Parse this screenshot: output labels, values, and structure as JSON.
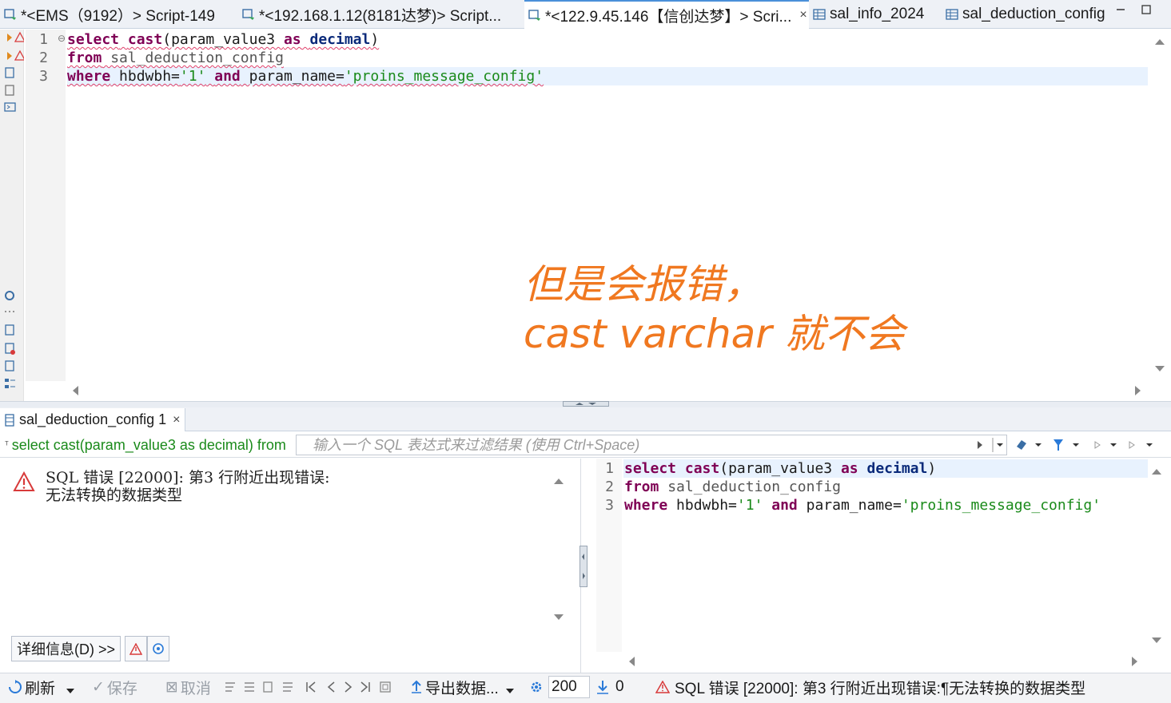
{
  "tabs": [
    {
      "label": "*<EMS（9192）> Script-149",
      "icon": "sql-script-icon",
      "active": false
    },
    {
      "label": "*<192.168.1.12(8181达梦)> Script...",
      "icon": "sql-script-icon",
      "active": false
    },
    {
      "label": "*<122.9.45.146【信创达梦】> Scri...",
      "icon": "sql-script-icon",
      "active": true,
      "close": "×"
    },
    {
      "label": "sal_info_2024",
      "icon": "table-icon",
      "active": false
    },
    {
      "label": "sal_deduction_config",
      "icon": "table-icon",
      "active": false
    }
  ],
  "editor": {
    "line_numbers": [
      "1",
      "2",
      "3"
    ],
    "lines": [
      [
        {
          "t": "select",
          "c": "kw"
        },
        {
          "t": " ",
          "c": "id"
        },
        {
          "t": "cast",
          "c": "kw"
        },
        {
          "t": "(param_value3 ",
          "c": "id"
        },
        {
          "t": "as",
          "c": "kw"
        },
        {
          "t": " ",
          "c": "id"
        },
        {
          "t": "decimal",
          "c": "kw2"
        },
        {
          "t": ")",
          "c": "id"
        }
      ],
      [
        {
          "t": "from",
          "c": "kw"
        },
        {
          "t": " sal_deduction_config",
          "c": "tbl"
        }
      ],
      [
        {
          "t": "where",
          "c": "kw"
        },
        {
          "t": " hbdwbh=",
          "c": "id"
        },
        {
          "t": "'1'",
          "c": "str"
        },
        {
          "t": " ",
          "c": "id"
        },
        {
          "t": "and",
          "c": "kw"
        },
        {
          "t": " param_name=",
          "c": "id"
        },
        {
          "t": "'proins_message_config'",
          "c": "str"
        }
      ]
    ]
  },
  "annotation": {
    "line1": "但是会报错，",
    "line2": "cast varchar 就不会"
  },
  "results": {
    "tab_label": "sal_deduction_config 1",
    "tab_close": "×",
    "filter_label": "select cast(param_value3 as decimal) from",
    "filter_placeholder": "输入一个 SQL 表达式来过滤结果 (使用 Ctrl+Space)",
    "error_line1": "SQL 错误 [22000]: 第3 行附近出现错误:",
    "error_line2": "无法转换的数据类型",
    "details_button": "详细信息(D) >>",
    "sql_line_numbers": [
      "1",
      "2",
      "3"
    ]
  },
  "bottom_toolbar": {
    "refresh": "刷新",
    "save": "保存",
    "cancel": "取消",
    "export": "导出数据...",
    "fetch_size": "200",
    "row_count": "0",
    "status": "SQL 错误 [22000]: 第3 行附近出现错误:¶无法转换的数据类型"
  },
  "colors": {
    "keyword": "#7f0055",
    "string": "#1a8a1a",
    "annotation": "#f07820",
    "error": "#d83a3a",
    "accent": "#2a7ad8"
  }
}
